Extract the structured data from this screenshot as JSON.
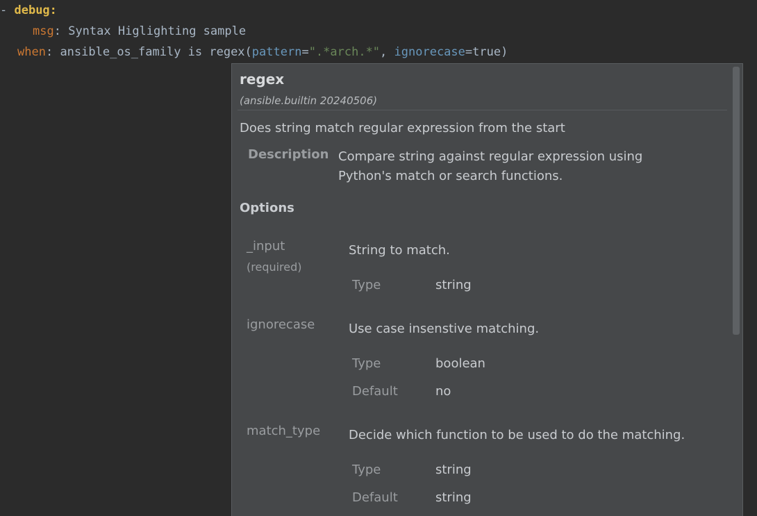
{
  "editor": {
    "line1": {
      "dash": "- ",
      "key": "debug",
      "colon": ":"
    },
    "line2": {
      "key": "msg",
      "colon": ": ",
      "value": "Syntax Higlighting sample"
    },
    "line3": {
      "key": "when",
      "colon": ": ",
      "expr": "ansible_os_family is regex(",
      "param1": "pattern",
      "eq1": "=",
      "string1": "\".*arch.*\"",
      "sep": ", ",
      "param2": "ignorecase",
      "eq2": "=",
      "const": "true",
      "close": ")"
    }
  },
  "popup": {
    "title": "regex",
    "subtitle": "(ansible.builtin 20240506)",
    "summary": "Does string match regular expression from the start",
    "description_label": "Description",
    "description_line1": "Compare string against regular expression using",
    "description_line2": "Python's match or search functions.",
    "options_heading": "Options",
    "options": [
      {
        "name": "_input",
        "required": "(required)",
        "description": "String to match.",
        "type_label": "Type",
        "type_value": "string"
      },
      {
        "name": "ignorecase",
        "description": "Use case insenstive matching.",
        "type_label": "Type",
        "type_value": "boolean",
        "default_label": "Default",
        "default_value": "no"
      },
      {
        "name": "match_type",
        "description": "Decide which function to be used to do the matching.",
        "type_label": "Type",
        "type_value": "string",
        "default_label": "Default",
        "default_value": "string"
      }
    ]
  },
  "colors": {
    "editor_bg": "#2b2b2b",
    "keyword": "#cc7832",
    "debug_key": "#e0b94a",
    "param": "#6897bb",
    "string": "#6a8759",
    "popup_bg": "#46484a"
  }
}
